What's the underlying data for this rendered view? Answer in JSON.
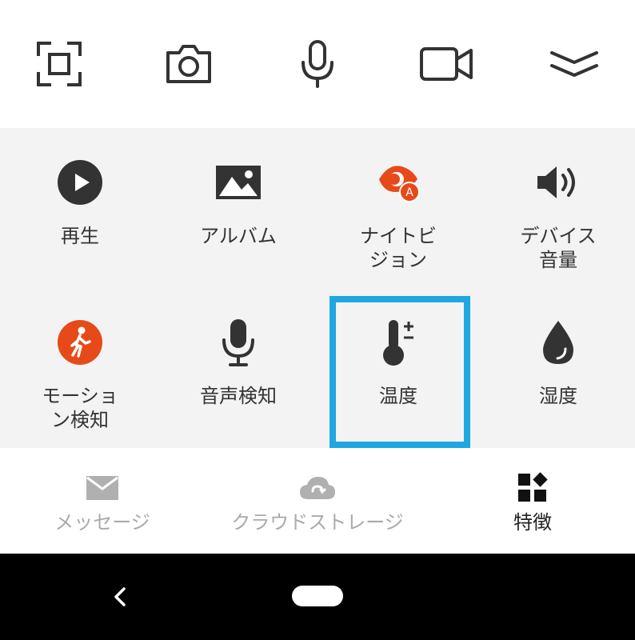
{
  "toolbar": {
    "items": [
      {
        "icon": "screenshot-frame-icon"
      },
      {
        "icon": "camera-icon"
      },
      {
        "icon": "microphone-icon"
      },
      {
        "icon": "video-camera-icon"
      },
      {
        "icon": "chevron-double-down-icon"
      }
    ]
  },
  "features": {
    "items": [
      {
        "label": "再生",
        "icon": "play-icon"
      },
      {
        "label": "アルバム",
        "icon": "album-icon"
      },
      {
        "label": "ナイトビ\nジョン",
        "icon": "night-vision-icon",
        "accent": "#e64a19"
      },
      {
        "label": "デバイス\n音量",
        "icon": "speaker-volume-icon"
      },
      {
        "label": "モーショ\nン検知",
        "icon": "motion-detection-icon",
        "accent": "#e64a19"
      },
      {
        "label": "音声検知",
        "icon": "sound-detection-icon"
      },
      {
        "label": "温度",
        "icon": "thermometer-icon"
      },
      {
        "label": "湿度",
        "icon": "humidity-drop-icon"
      }
    ],
    "highlight_color": "#1ea7e1"
  },
  "bottom_nav": {
    "items": [
      {
        "label": "メッセージ",
        "icon": "envelope-icon"
      },
      {
        "label": "クラウドストレージ",
        "icon": "cloud-storage-icon"
      },
      {
        "label": "特徴",
        "icon": "features-grid-icon",
        "active": true
      }
    ]
  },
  "system_nav": {
    "back_icon": "back-chevron-icon",
    "home": "home-pill"
  }
}
